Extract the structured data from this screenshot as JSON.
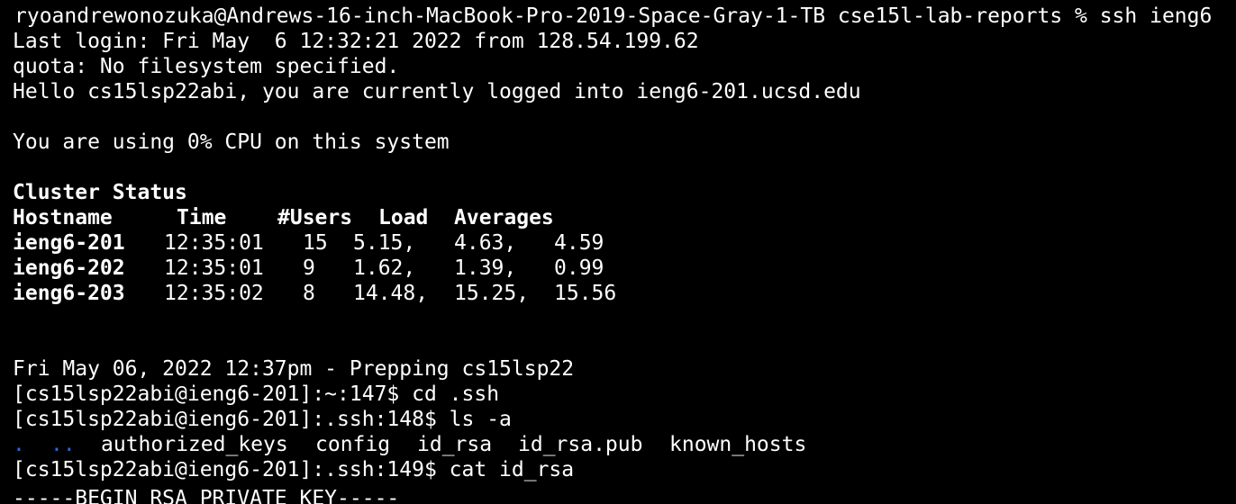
{
  "terminal": {
    "colors": {
      "background": "#000000",
      "foreground": "#ffffff",
      "directory": "#2b63f2"
    },
    "command_line": "ryoandrewonozuka@Andrews-16-inch-MacBook-Pro-2019-Space-Gray-1-TB cse15l-lab-reports % ssh ieng6",
    "last_login": "Last login: Fri May  6 12:32:21 2022 from 128.54.199.62",
    "quota": "quota: No filesystem specified.",
    "hello": "Hello cs15lsp22abi, you are currently logged into ieng6-201.ucsd.edu",
    "cpu": "You are using 0% CPU on this system",
    "cluster_title": "Cluster Status",
    "cluster_headers": {
      "hostname": "Hostname",
      "time": "Time",
      "users": "#Users",
      "load": "Load",
      "averages": "Averages"
    },
    "cluster_rows": [
      {
        "host": "ieng6-201",
        "time": "12:35:01",
        "users": "15",
        "l1": "5.15,",
        "l5": "4.63,",
        "l15": "4.59"
      },
      {
        "host": "ieng6-202",
        "time": "12:35:01",
        "users": "9",
        "l1": "1.62,",
        "l5": "1.39,",
        "l15": "0.99"
      },
      {
        "host": "ieng6-203",
        "time": "12:35:02",
        "users": "8",
        "l1": "14.48,",
        "l5": "15.25,",
        "l15": "15.56"
      }
    ],
    "prep_line": "Fri May 06, 2022 12:37pm - Prepping cs15lsp22",
    "cmd_cd": "[cs15lsp22abi@ieng6-201]:~:147$ cd .ssh",
    "cmd_ls": "[cs15lsp22abi@ieng6-201]:.ssh:148$ ls -a",
    "ls_output": {
      "dot": ".",
      "dotdot": "..",
      "files": [
        "authorized_keys",
        "config",
        "id_rsa",
        "id_rsa.pub",
        "known_hosts"
      ]
    },
    "cmd_cat": "[cs15lsp22abi@ieng6-201]:.ssh:149$ cat id_rsa",
    "key_begin": "-----BEGIN RSA PRIVATE KEY-----"
  }
}
